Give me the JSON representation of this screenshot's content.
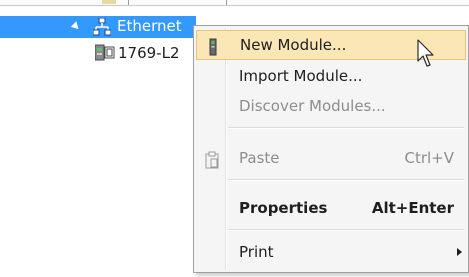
{
  "tree": {
    "ethernet_label": "Ethernet",
    "device_label": "1769-L2"
  },
  "context_menu": {
    "items": [
      {
        "label": "New Module...",
        "shortcut": "",
        "state": "hover"
      },
      {
        "label": "Import Module...",
        "shortcut": "",
        "state": "normal"
      },
      {
        "label": "Discover Modules...",
        "shortcut": "",
        "state": "disabled"
      },
      {
        "label": "Paste",
        "shortcut": "Ctrl+V",
        "state": "disabled"
      },
      {
        "label": "Properties",
        "shortcut": "Alt+Enter",
        "state": "bold"
      },
      {
        "label": "Print",
        "shortcut": "",
        "state": "submenu"
      }
    ]
  },
  "colors": {
    "selection": "#3399ff",
    "menu_hover": "#fbe7b5",
    "menu_background": "#f5f5f5"
  },
  "icons": {
    "expander": "expanded-triangle-icon",
    "ethernet": "network-icon",
    "device": "controller-icon",
    "new_module": "module-icon",
    "paste": "clipboard-icon",
    "submenu": "submenu-arrow-icon",
    "cursor": "mouse-pointer-icon"
  }
}
